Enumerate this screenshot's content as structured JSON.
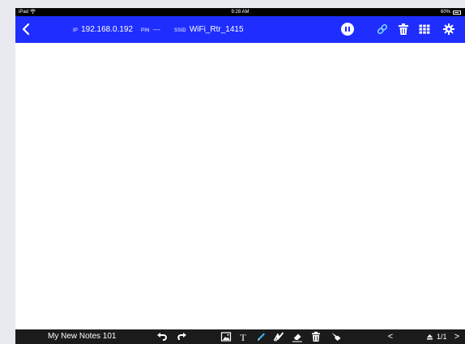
{
  "status_bar": {
    "device": "iPad",
    "time": "9:28 AM",
    "battery": "60%"
  },
  "top_bar": {
    "ip_label": "IP",
    "ip_value": "192.168.0.192",
    "pin_label": "PIN",
    "pin_value": "----",
    "ssid_label": "SSID",
    "ssid_value": "WiFi_Rtr_1415",
    "icons": [
      "back-chevron",
      "pause",
      "link",
      "trash-can",
      "grid",
      "gear"
    ]
  },
  "bottom_bar": {
    "note_title": "My New Notes 101",
    "tools": [
      "undo",
      "redo",
      "insert-image",
      "text",
      "pen",
      "highlighter",
      "eraser",
      "delete",
      "pointer"
    ],
    "prev": "<",
    "next": ">",
    "page": "1/1"
  },
  "colors": {
    "accent": "#1f2eff",
    "bottom_bar": "#1b1b1b",
    "pen_blue": "#3ab4ff"
  }
}
